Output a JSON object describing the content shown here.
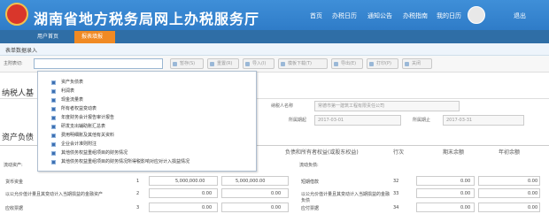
{
  "header": {
    "title": "湖南省地方税务局网上办税服务厅",
    "nav": [
      "首页",
      "办税日历",
      "通知公告",
      "办税指南",
      "我的日历"
    ],
    "logout": "退出"
  },
  "tabs": [
    {
      "label": "用户首页"
    },
    {
      "label": "报表填报"
    }
  ],
  "panel": {
    "title": "表单数据录入"
  },
  "toolbar": {
    "select_label": "主附表切:",
    "buttons": [
      "暂存(S)",
      "重置(R)",
      "导入(I)",
      "模板下载(T)",
      "导出(E)",
      "打印(P)",
      "关闭"
    ]
  },
  "form": {
    "section1": "纳税人基",
    "taxpayer_label": "纳税人名称",
    "taxpayer_value": "常德市第一建筑工程有限责任公司",
    "period_label": "所属期起",
    "period_value": "2017-03-01",
    "period_end_label": "所属期止",
    "period_end_value": "2017-03-31"
  },
  "dropdown": {
    "items": [
      "资产负债表",
      "利润表",
      "现金流量表",
      "所有者权益变动表",
      "年度财务会计报告审计报告",
      "研发支出辅助账汇总表",
      "费用明细账及其他有关资料",
      "企业会计准则附注",
      "其他债务权益重组项目的财务情况",
      "其他债务权益重组项目的财务情况所得税影响对应对计入损益情况"
    ]
  },
  "table": {
    "section": "资产负债",
    "headers": [
      "负债和所有者权益(或股东权益)",
      "行次",
      "期末余额",
      "年初余额"
    ],
    "rows": [
      {
        "left": "流动资产:",
        "right": "流动负债:",
        "line": ""
      },
      {
        "left": "货币资金",
        "left_line": "1",
        "left_val1": "5,000,000.00",
        "left_val2": "5,000,000.00",
        "right": "短期借款",
        "line": "32",
        "right_val1": "0.00",
        "right_val2": "0.00"
      },
      {
        "left": "以公允价值计量且其变动计入当期损益的金融资产",
        "left_line": "2",
        "left_val1": "0.00",
        "left_val2": "0.00",
        "right": "以公允价值计量且其变动计入当期损益的金融负债",
        "line": "33",
        "right_val1": "0.00",
        "right_val2": "0.00"
      },
      {
        "left": "应收票据",
        "left_line": "3",
        "left_val1": "0.00",
        "left_val2": "0.00",
        "right": "应付票据",
        "line": "34",
        "right_val1": "0.00",
        "right_val2": "0.00"
      }
    ]
  }
}
